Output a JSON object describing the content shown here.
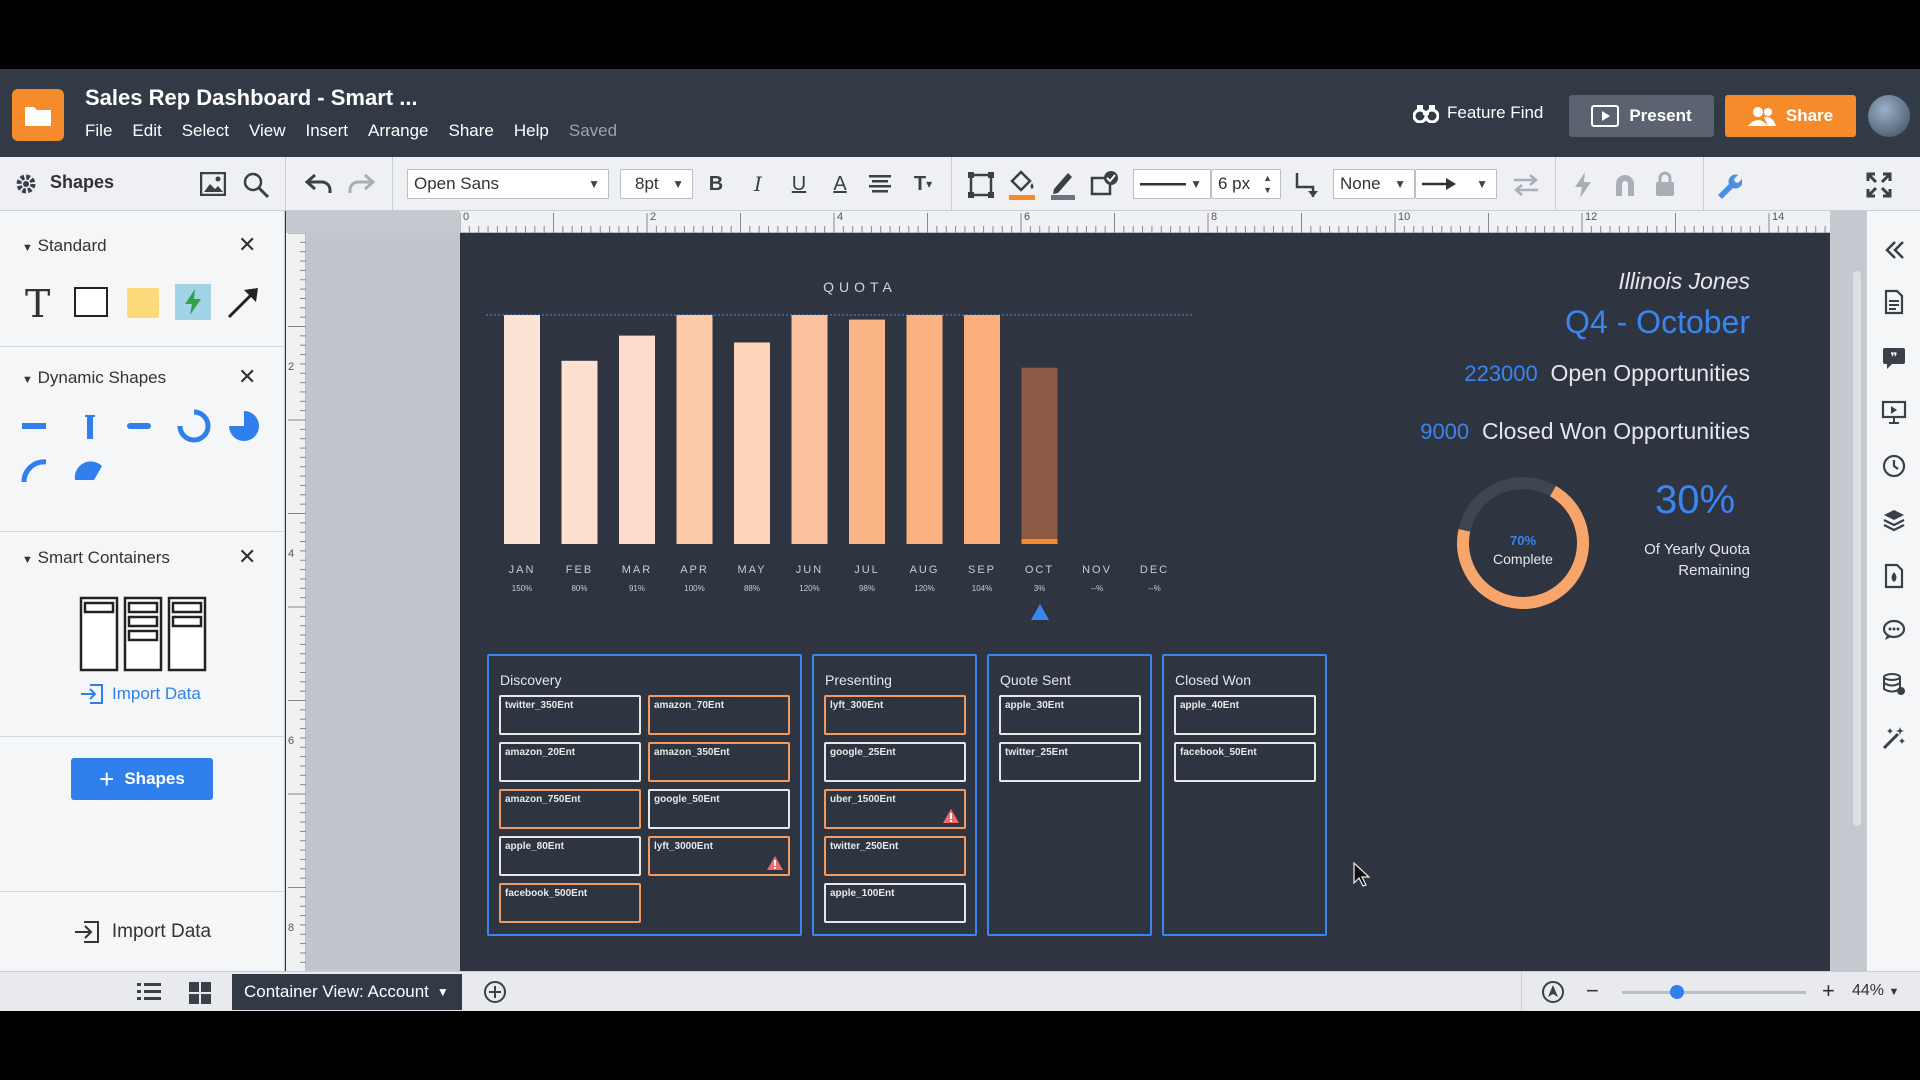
{
  "app": {
    "title": "Sales Rep Dashboard - Smart ...",
    "menu": [
      "File",
      "Edit",
      "Select",
      "View",
      "Insert",
      "Arrange",
      "Share",
      "Help"
    ],
    "saved_status": "Saved",
    "feature_find": "Feature Find",
    "present_label": "Present",
    "share_label": "Share",
    "accent_color": "#f68b2c"
  },
  "toolbar": {
    "shapes_label": "Shapes",
    "font_family": "Open Sans",
    "font_size": "8pt",
    "line_width": "6 px",
    "arrow_start": "None"
  },
  "left_panel": {
    "standard_title": "Standard",
    "dynamic_title": "Dynamic Shapes",
    "smart_title": "Smart Containers",
    "import_data": "Import Data",
    "add_shapes": "Shapes",
    "bottom_import": "Import Data"
  },
  "ruler": {
    "h_labels": [
      "0",
      "2",
      "4",
      "6",
      "8",
      "10",
      "12",
      "14"
    ],
    "v_labels": [
      "2",
      "4",
      "6",
      "8"
    ]
  },
  "dashboard": {
    "rep_name": "Illinois Jones",
    "period": "Q4 - October",
    "open_opps_value": "223000",
    "open_opps_label": "Open Opportunities",
    "closed_value": "9000",
    "closed_label": "Closed Won Opportunities",
    "donut_pct": "70%",
    "donut_label": "Complete",
    "donut_fraction": 0.7,
    "remaining_pct": "30%",
    "remaining_label_1": "Of Yearly Quota",
    "remaining_label_2": "Remaining"
  },
  "chart_data": {
    "type": "bar",
    "title": "QUOTA",
    "categories": [
      "JAN",
      "FEB",
      "MAR",
      "APR",
      "MAY",
      "JUN",
      "JUL",
      "AUG",
      "SEP",
      "OCT",
      "NOV",
      "DEC"
    ],
    "pct_labels": [
      "150%",
      "80%",
      "91%",
      "100%",
      "88%",
      "120%",
      "98%",
      "120%",
      "104%",
      "3%",
      "--%",
      "--%"
    ],
    "values": [
      100,
      80,
      91,
      100,
      88,
      100,
      98,
      100,
      100,
      77,
      null,
      null
    ],
    "ylim": [
      0,
      100
    ],
    "colors": [
      "#fde3d4",
      "#fde0cf",
      "#fddccb",
      "#fcc9a9",
      "#fdd3b9",
      "#fcc19e",
      "#fbb587",
      "#fbb283",
      "#fbad7c",
      "#8c5a45",
      null,
      null
    ],
    "current_month": "OCT"
  },
  "pipeline": {
    "columns": [
      {
        "title": "Discovery",
        "cards": [
          {
            "label": "twitter_350Ent",
            "orange": false,
            "warn": false
          },
          {
            "label": "amazon_70Ent",
            "orange": true,
            "warn": false
          },
          {
            "label": "amazon_20Ent",
            "orange": false,
            "warn": false
          },
          {
            "label": "amazon_350Ent",
            "orange": true,
            "warn": false
          },
          {
            "label": "amazon_750Ent",
            "orange": true,
            "warn": false
          },
          {
            "label": "google_50Ent",
            "orange": false,
            "warn": false
          },
          {
            "label": "apple_80Ent",
            "orange": false,
            "warn": false
          },
          {
            "label": "lyft_3000Ent",
            "orange": true,
            "warn": true
          },
          {
            "label": "facebook_500Ent",
            "orange": true,
            "warn": false
          }
        ]
      },
      {
        "title": "Presenting",
        "cards": [
          {
            "label": "lyft_300Ent",
            "orange": true,
            "warn": false
          },
          {
            "label": "google_25Ent",
            "orange": false,
            "warn": false
          },
          {
            "label": "uber_1500Ent",
            "orange": true,
            "warn": true
          },
          {
            "label": "twitter_250Ent",
            "orange": true,
            "warn": false
          },
          {
            "label": "apple_100Ent",
            "orange": false,
            "warn": false
          }
        ]
      },
      {
        "title": "Quote Sent",
        "cards": [
          {
            "label": "apple_30Ent",
            "orange": false,
            "warn": false
          },
          {
            "label": "twitter_25Ent",
            "orange": false,
            "warn": false
          }
        ]
      },
      {
        "title": "Closed Won",
        "cards": [
          {
            "label": "apple_40Ent",
            "orange": false,
            "warn": false
          },
          {
            "label": "facebook_50Ent",
            "orange": false,
            "warn": false
          }
        ]
      }
    ]
  },
  "status": {
    "container_view": "Container View: Account",
    "zoom": "44%",
    "zoom_fraction": 0.3
  }
}
